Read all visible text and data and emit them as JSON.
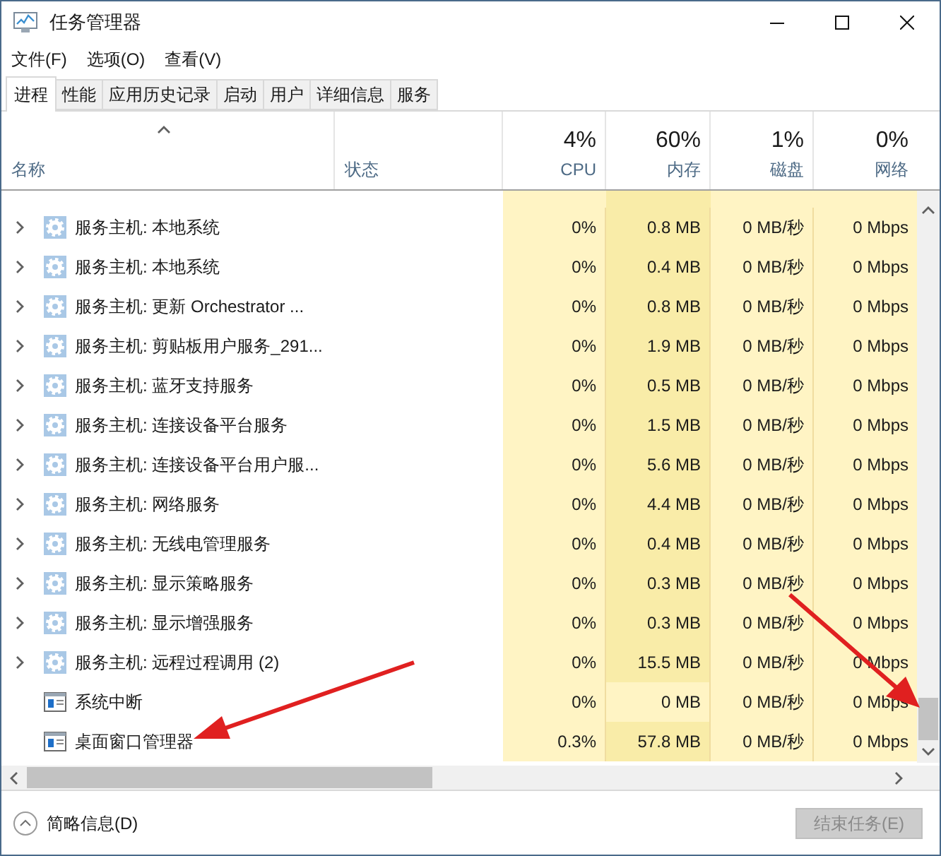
{
  "window": {
    "title": "任务管理器"
  },
  "menu": [
    "文件(F)",
    "选项(O)",
    "查看(V)"
  ],
  "tabs": [
    {
      "label": "进程",
      "selected": true
    },
    {
      "label": "性能",
      "selected": false
    },
    {
      "label": "应用历史记录",
      "selected": false
    },
    {
      "label": "启动",
      "selected": false
    },
    {
      "label": "用户",
      "selected": false
    },
    {
      "label": "详细信息",
      "selected": false
    },
    {
      "label": "服务",
      "selected": false
    }
  ],
  "table": {
    "columns": [
      {
        "label": "名称"
      },
      {
        "label": "状态"
      },
      {
        "usage": "4%",
        "label": "CPU"
      },
      {
        "usage": "60%",
        "label": "内存"
      },
      {
        "usage": "1%",
        "label": "磁盘"
      },
      {
        "usage": "0%",
        "label": "网络"
      }
    ],
    "rows": [
      {
        "kind": "service",
        "name": "服务主机: 本地系统",
        "cpu": "0%",
        "memory": "0.8 MB",
        "disk": "0 MB/秒",
        "network": "0 Mbps",
        "memory_busy": true
      },
      {
        "kind": "service",
        "name": "服务主机: 本地系统",
        "cpu": "0%",
        "memory": "0.4 MB",
        "disk": "0 MB/秒",
        "network": "0 Mbps",
        "memory_busy": true
      },
      {
        "kind": "service",
        "name": "服务主机: 更新 Orchestrator ...",
        "cpu": "0%",
        "memory": "0.8 MB",
        "disk": "0 MB/秒",
        "network": "0 Mbps",
        "memory_busy": true
      },
      {
        "kind": "service",
        "name": "服务主机: 剪贴板用户服务_291...",
        "cpu": "0%",
        "memory": "1.9 MB",
        "disk": "0 MB/秒",
        "network": "0 Mbps",
        "memory_busy": true
      },
      {
        "kind": "service",
        "name": "服务主机: 蓝牙支持服务",
        "cpu": "0%",
        "memory": "0.5 MB",
        "disk": "0 MB/秒",
        "network": "0 Mbps",
        "memory_busy": true
      },
      {
        "kind": "service",
        "name": "服务主机: 连接设备平台服务",
        "cpu": "0%",
        "memory": "1.5 MB",
        "disk": "0 MB/秒",
        "network": "0 Mbps",
        "memory_busy": true
      },
      {
        "kind": "service",
        "name": "服务主机: 连接设备平台用户服...",
        "cpu": "0%",
        "memory": "5.6 MB",
        "disk": "0 MB/秒",
        "network": "0 Mbps",
        "memory_busy": true
      },
      {
        "kind": "service",
        "name": "服务主机: 网络服务",
        "cpu": "0%",
        "memory": "4.4 MB",
        "disk": "0 MB/秒",
        "network": "0 Mbps",
        "memory_busy": true
      },
      {
        "kind": "service",
        "name": "服务主机: 无线电管理服务",
        "cpu": "0%",
        "memory": "0.4 MB",
        "disk": "0 MB/秒",
        "network": "0 Mbps",
        "memory_busy": true
      },
      {
        "kind": "service",
        "name": "服务主机: 显示策略服务",
        "cpu": "0%",
        "memory": "0.3 MB",
        "disk": "0 MB/秒",
        "network": "0 Mbps",
        "memory_busy": true
      },
      {
        "kind": "service",
        "name": "服务主机: 显示增强服务",
        "cpu": "0%",
        "memory": "0.3 MB",
        "disk": "0 MB/秒",
        "network": "0 Mbps",
        "memory_busy": true
      },
      {
        "kind": "service",
        "name": "服务主机: 远程过程调用 (2)",
        "cpu": "0%",
        "memory": "15.5 MB",
        "disk": "0 MB/秒",
        "network": "0 Mbps",
        "memory_busy": true
      },
      {
        "kind": "process",
        "name": "系统中断",
        "cpu": "0%",
        "memory": "0 MB",
        "disk": "0 MB/秒",
        "network": "0 Mbps",
        "memory_busy": false
      },
      {
        "kind": "process",
        "name": "桌面窗口管理器",
        "cpu": "0.3%",
        "memory": "57.8 MB",
        "disk": "0 MB/秒",
        "network": "0 Mbps",
        "memory_busy": true
      }
    ]
  },
  "footer": {
    "details_toggle": "简略信息(D)",
    "end_task": {
      "label": "结束任务(E)",
      "disabled": true
    }
  }
}
